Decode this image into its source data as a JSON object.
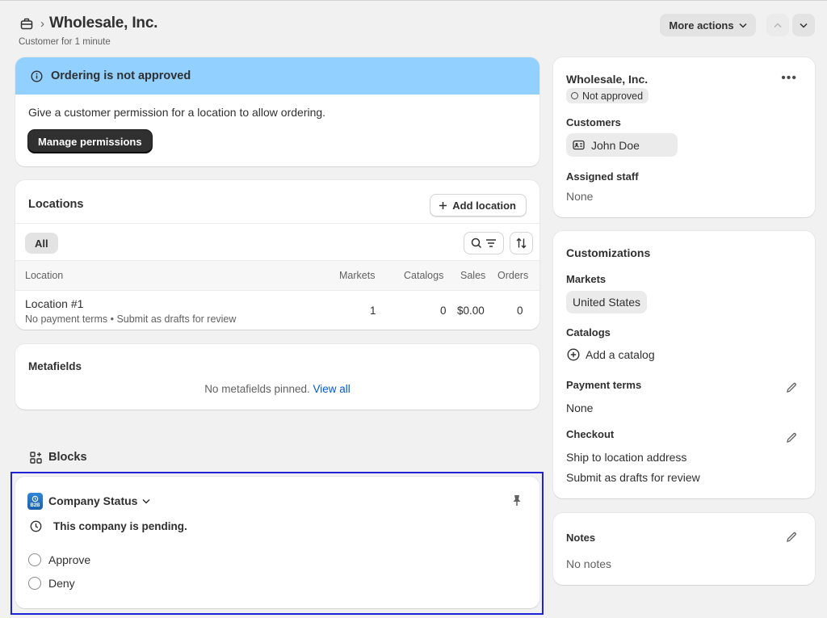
{
  "header": {
    "title": "Wholesale, Inc.",
    "subtitle": "Customer for 1 minute",
    "more_actions": "More actions"
  },
  "banner": {
    "title": "Ordering is not approved",
    "description": "Give a customer permission for a location to allow ordering.",
    "button": "Manage permissions",
    "color": "#91d0ff"
  },
  "locations": {
    "title": "Locations",
    "add_button": "Add location",
    "filter_all": "All",
    "columns": [
      "Location",
      "Markets",
      "Catalogs",
      "Sales",
      "Orders"
    ],
    "rows": [
      {
        "name": "Location #1",
        "details": "No payment terms • Submit as drafts for review",
        "markets": "1",
        "catalogs": "0",
        "sales": "$0.00",
        "orders": "0"
      }
    ]
  },
  "metafields": {
    "title": "Metafields",
    "empty_text": "No metafields pinned.",
    "link": "View all"
  },
  "blocks": {
    "heading": "Blocks",
    "app_badge": "B2B",
    "title": "Company Status",
    "status_text": "This company is pending.",
    "options": [
      "Approve",
      "Deny"
    ]
  },
  "company": {
    "name": "Wholesale, Inc.",
    "status": "Not approved",
    "customers_label": "Customers",
    "customer_name": "John Doe",
    "assigned_staff_label": "Assigned staff",
    "assigned_staff_value": "None"
  },
  "customizations": {
    "title": "Customizations",
    "markets_label": "Markets",
    "market_value": "United States",
    "catalogs_label": "Catalogs",
    "add_catalog": "Add a catalog",
    "payment_terms_label": "Payment terms",
    "payment_terms_value": "None",
    "checkout_label": "Checkout",
    "checkout_line1": "Ship to location address",
    "checkout_line2": "Submit as drafts for review"
  },
  "notes": {
    "title": "Notes",
    "value": "No notes"
  },
  "colors": {
    "background": "#f1f1f1",
    "link": "#005bd3",
    "selection": "#1f22d6",
    "dark_button": "#303030"
  }
}
